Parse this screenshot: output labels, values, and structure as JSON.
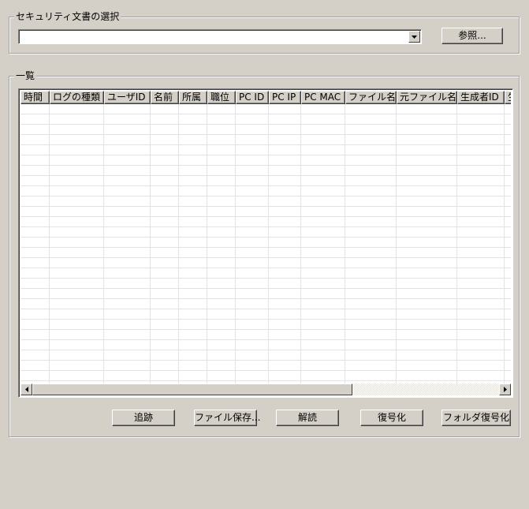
{
  "security_doc_group": {
    "title": "セキュリティ文書の選択",
    "combo_value": "",
    "browse_label": "参照..."
  },
  "list_group": {
    "title": "一覧",
    "columns": [
      "時間",
      "ログの種類",
      "ユーザID",
      "名前",
      "所属",
      "職位",
      "PC ID",
      "PC IP",
      "PC MAC",
      "ファイル名",
      "元ファイル名",
      "生成者ID",
      "生"
    ]
  },
  "actions": {
    "trace_label": "追跡",
    "save_file_label": "ファイル保存...",
    "decode_label": "解読",
    "decrypt_label": "復号化",
    "folder_decrypt_label": "フォルダ復号化"
  },
  "icons": {
    "combo_dropdown": "triangle-down-icon",
    "scroll_left": "triangle-left-icon",
    "scroll_right": "triangle-right-icon"
  }
}
